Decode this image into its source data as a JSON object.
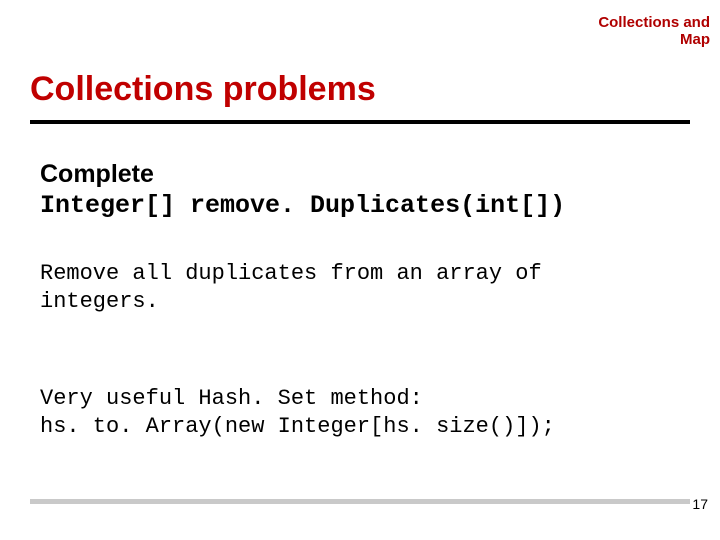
{
  "header": {
    "label_line1": "Collections and",
    "label_line2": "Map"
  },
  "title": "Collections problems",
  "content": {
    "complete_label": "Complete",
    "signature": "Integer[] remove. Duplicates(int[])",
    "description": "Remove all duplicates from an array of integers.",
    "hint_line1": "Very useful Hash. Set method:",
    "hint_line2": "hs. to. Array(new Integer[hs. size()]);"
  },
  "page_number": "17"
}
